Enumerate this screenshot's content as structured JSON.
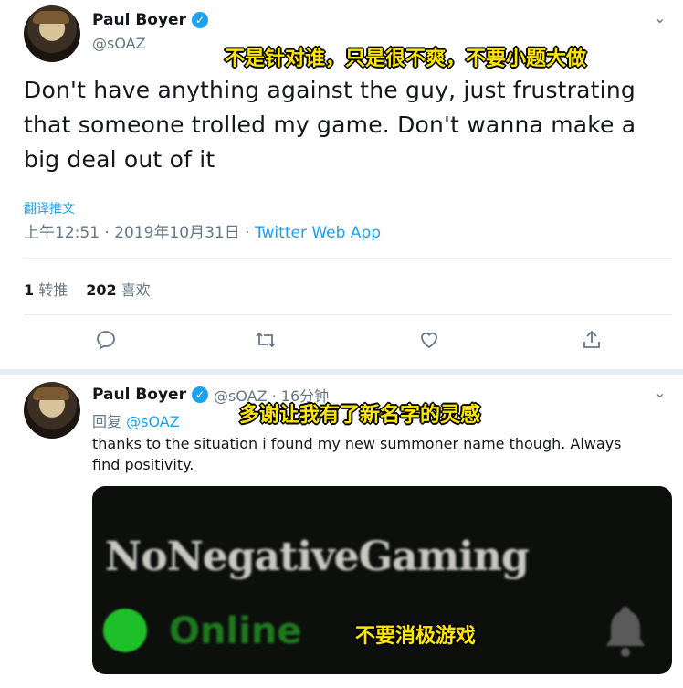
{
  "tweet": {
    "author_name": "Paul Boyer",
    "author_handle": "@sOAZ",
    "text": "Don't have anything against the guy, just frustrating that someone trolled my game. Don't wanna make a big deal out of it",
    "translate_label": "翻译推文",
    "timestamp": "上午12:51 · 2019年10月31日 · ",
    "source": "Twitter Web App",
    "retweet_count": "1",
    "retweet_label": "转推",
    "like_count": "202",
    "like_label": "喜欢",
    "caption": "不是针对谁，只是很不爽，不要小题大做"
  },
  "reply": {
    "author_name": "Paul Boyer",
    "author_handle": "@sOAZ · 16分钟",
    "reply_prefix": "回复",
    "reply_to": "@sOAZ",
    "text": "thanks to the situation i found my new summoner name though. Always find positivity.",
    "caption": "多谢让我有了新名字的灵感",
    "card": {
      "summoner_name": "NoNegativeGaming",
      "status": "Online",
      "caption": "不要消极游戏"
    }
  },
  "icons": {
    "verified": "verified-badge-icon",
    "chevron": "chevron-down-icon",
    "reply": "reply-icon",
    "retweet": "retweet-icon",
    "like": "heart-icon",
    "share": "share-icon",
    "bell": "bell-icon"
  },
  "colors": {
    "accent": "#1da1f2",
    "caption": "#ffe600",
    "online": "#1fbf2a"
  }
}
